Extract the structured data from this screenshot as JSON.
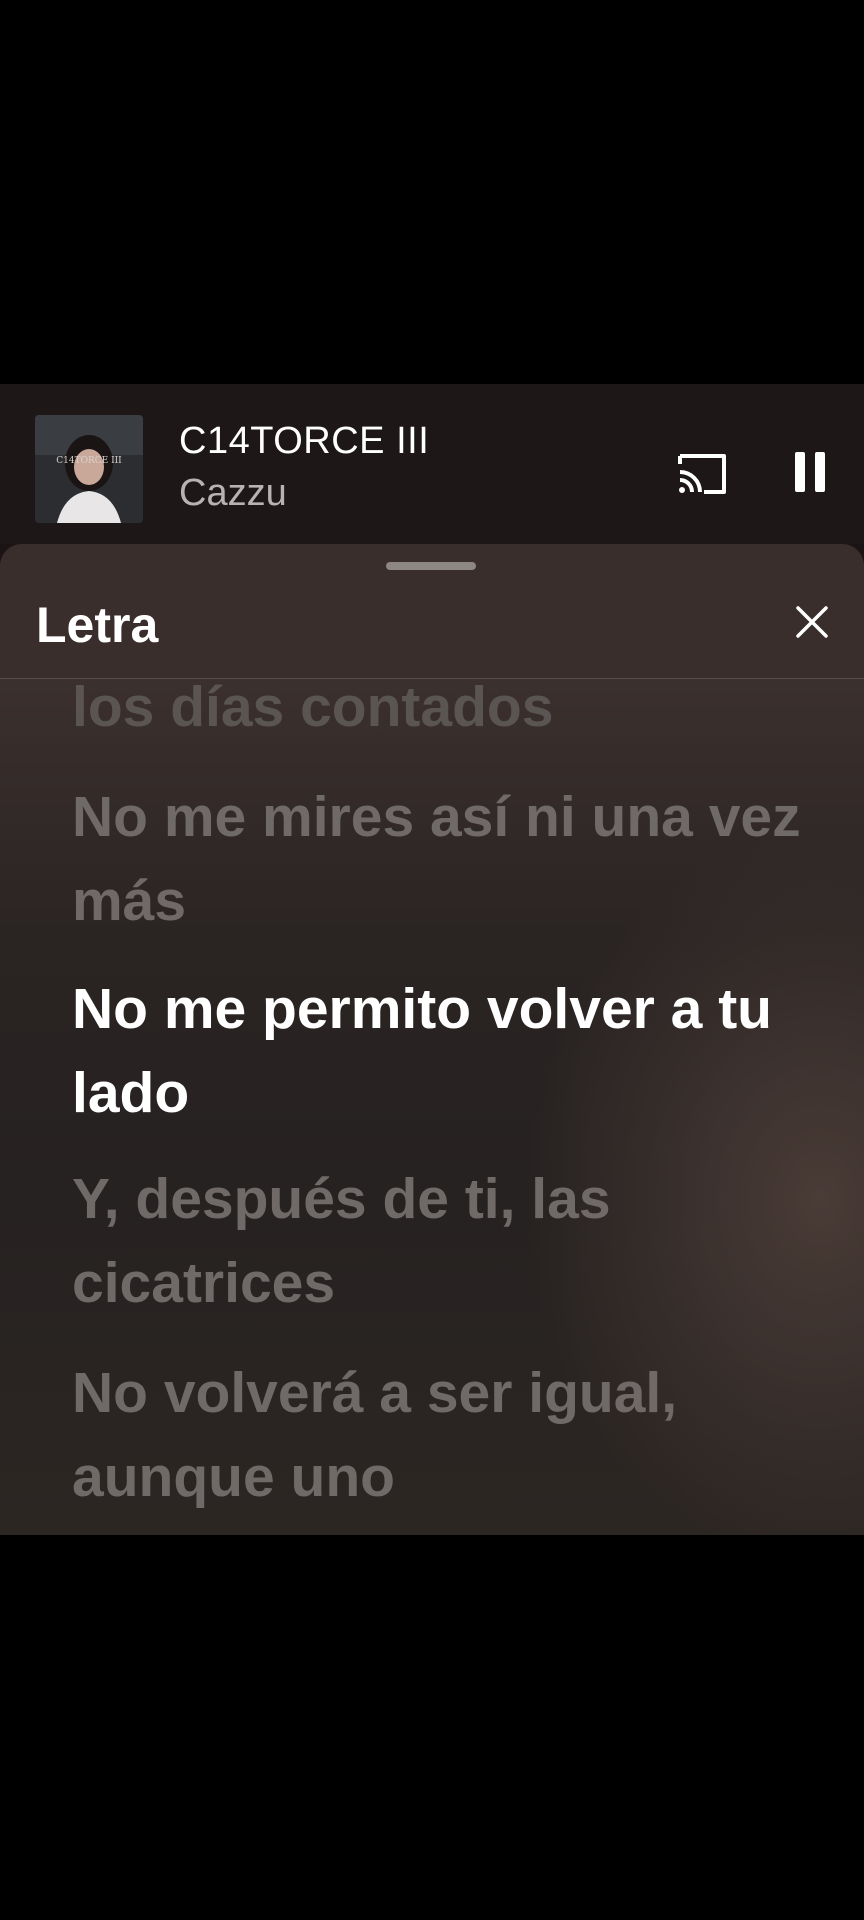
{
  "now_playing": {
    "title": "C14TORCE III",
    "artist": "Cazzu",
    "album_art_text": "C14TORCE III"
  },
  "controls": {
    "cast_icon": "cast-icon",
    "pause_icon": "pause-icon"
  },
  "lyrics_panel": {
    "title": "Letra",
    "close_icon": "close-icon",
    "lines": [
      "los días contados",
      "No me mires así ni una vez más",
      "No me permito volver a tu lado",
      "Y, después de ti, las cicatrices",
      "No volverá a ser igual, aunque uno"
    ],
    "active_line_index": 2
  },
  "colors": {
    "active_lyric": "#ffffff",
    "inactive_lyric": "#6f6967",
    "header_bg": "#3a2e2d",
    "mini_player_bg": "#1e1717"
  }
}
